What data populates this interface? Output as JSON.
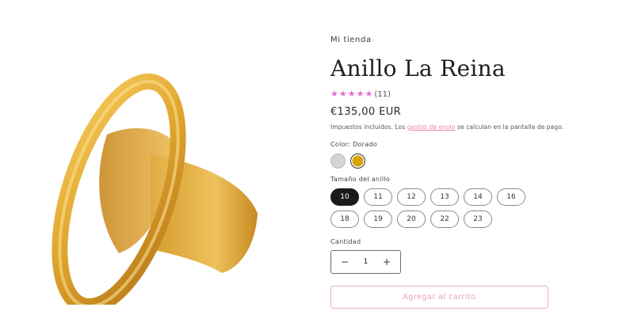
{
  "store": {
    "name": "Mi tienda"
  },
  "product": {
    "title": "Anillo La Reina",
    "rating": {
      "stars": 5,
      "count_label": "(11)"
    },
    "price": "€135,00 EUR",
    "tax_note": {
      "before": "Impuestos incluidos. Los ",
      "link": "gastos de envío",
      "after": " se calculan en la pantalla de pago."
    },
    "color": {
      "label": "Color: Dorado",
      "options": [
        {
          "name": "Plateado",
          "hex": "#d4d4d4"
        },
        {
          "name": "Dorado",
          "hex": "#d9a400",
          "selected": true
        }
      ]
    },
    "size": {
      "label": "Tamaño del anillo",
      "options": [
        "10",
        "11",
        "12",
        "13",
        "14",
        "16",
        "18",
        "19",
        "20",
        "22",
        "23"
      ],
      "selected": "10"
    },
    "quantity": {
      "label": "Cantidad",
      "value": "1",
      "minus": "−",
      "plus": "+"
    },
    "add_to_cart": "Agregar al carrito"
  },
  "colors": {
    "accent": "#e36ad4",
    "link": "#e87fa8",
    "cart_border": "#ecaec8",
    "gold": "#d9a400"
  },
  "icons": {
    "star": "star-icon",
    "minus": "minus-icon",
    "plus": "plus-icon"
  }
}
